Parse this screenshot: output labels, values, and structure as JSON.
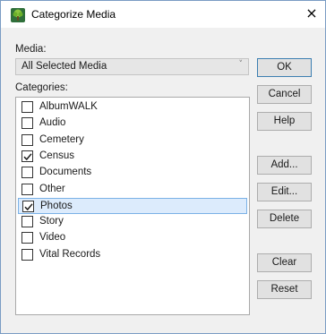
{
  "window": {
    "title": "Categorize Media",
    "close_glyph": "×"
  },
  "media": {
    "label": "Media:",
    "selected": "All Selected Media"
  },
  "categories": {
    "label": "Categories:",
    "items": [
      {
        "label": "AlbumWALK",
        "checked": false,
        "selected": false
      },
      {
        "label": "Audio",
        "checked": false,
        "selected": false
      },
      {
        "label": "Cemetery",
        "checked": false,
        "selected": false
      },
      {
        "label": "Census",
        "checked": true,
        "selected": false
      },
      {
        "label": "Documents",
        "checked": false,
        "selected": false
      },
      {
        "label": "Other",
        "checked": false,
        "selected": false
      },
      {
        "label": "Photos",
        "checked": true,
        "selected": true
      },
      {
        "label": "Story",
        "checked": false,
        "selected": false
      },
      {
        "label": "Video",
        "checked": false,
        "selected": false
      },
      {
        "label": "Vital Records",
        "checked": false,
        "selected": false
      }
    ]
  },
  "buttons": {
    "ok": "OK",
    "cancel": "Cancel",
    "help": "Help",
    "add": "Add...",
    "edit": "Edit...",
    "delete": "Delete",
    "clear": "Clear",
    "reset": "Reset"
  },
  "colors": {
    "selection_fill": "#dcebfc",
    "selection_border": "#7ab1e6",
    "default_button_border": "#3c7fb1",
    "app_icon": "#2f8f3a"
  },
  "icons": {
    "app": "tree-icon",
    "close": "close-icon",
    "dropdown": "chevron-down-icon",
    "check": "checkmark-icon"
  }
}
